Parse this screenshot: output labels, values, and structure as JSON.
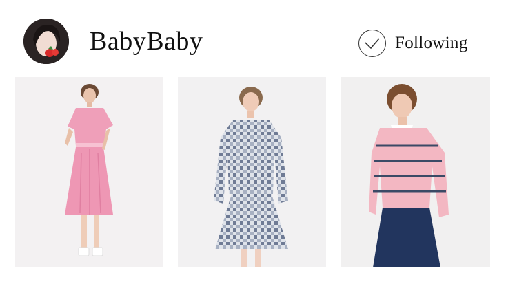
{
  "profile": {
    "username": "BabyBaby",
    "avatar_icon": "profile-photo"
  },
  "follow": {
    "label": "Following",
    "icon": "check-circle-icon"
  },
  "products": [
    {
      "image": "pink-shirt-dress-photo",
      "color": "#f0a3bd"
    },
    {
      "image": "check-jacket-skirt-set-photo",
      "color": "#8a93a8"
    },
    {
      "image": "pink-striped-sweater-photo",
      "color": "#f2b9c3"
    }
  ]
}
